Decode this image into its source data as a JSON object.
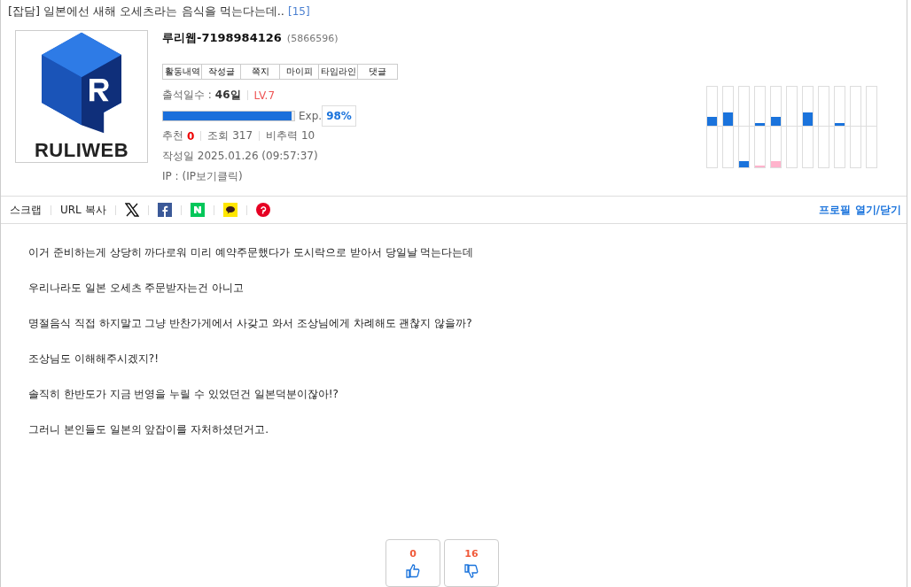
{
  "post": {
    "category": "[잡담]",
    "title": "일본에선 새해 오세츠라는 음식을 먹는다는데..",
    "comment_count": "[15]"
  },
  "profile": {
    "nickname": "루리웹-7198984126",
    "member_no": "(5866596)",
    "menu": [
      "활동내역",
      "작성글",
      "쪽지",
      "마이피",
      "타임라인",
      "댓글"
    ],
    "attendance_label": "출석일수 :",
    "attendance_value": "46일",
    "level_text": "LV.7",
    "exp": {
      "level": 0.98,
      "label": "Exp.",
      "percent": "98%"
    },
    "recommend_label": "추천",
    "recommend_value": "0",
    "views": "조회 317",
    "ratio": "비추력 10",
    "date": "작성일 2025.01.26 (09:57:37)",
    "ip": "IP : (IP보기클릭)"
  },
  "logo": {
    "wordmark": "RULIWEB"
  },
  "share_bar": {
    "items": [
      {
        "kind": "text",
        "label": "스크랩"
      },
      {
        "kind": "text",
        "label": "URL 복사"
      },
      {
        "kind": "x"
      },
      {
        "kind": "facebook"
      },
      {
        "kind": "naver"
      },
      {
        "kind": "kakao"
      },
      {
        "kind": "pinterest"
      }
    ],
    "profile_toggle": "프로필 열기/닫기"
  },
  "body": [
    "이거 준비하는게 상당히 까다로워 미리 예약주문했다가 도시락으로 받아서 당일날 먹는다는데",
    "우리나라도 일본 오세츠 주문받자는건 아니고",
    "명절음식 직접 하지말고 그냥 반찬가게에서 사갖고 와서 조상님에게 차례해도 괜찮지 않을까?",
    "조상님도 이해해주시겠지?!",
    "솔직히 한반도가 지금 번영을 누릴 수 있었던건 일본덕분이잖아!?",
    "그러니 본인들도 일본의 앞잡이를 자처하셨던거고."
  ],
  "votes": {
    "up": "0",
    "down": "16"
  }
}
